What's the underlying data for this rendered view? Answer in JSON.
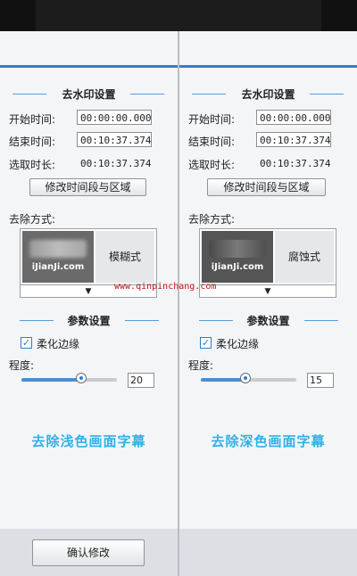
{
  "watermark_site": "www.qinpinchang.com",
  "panels": [
    {
      "section_title": "去水印设置",
      "start_label": "开始时间:",
      "start_value": "00:00:00.000",
      "end_label": "结束时间:",
      "end_value": "00:10:37.374",
      "duration_label": "选取时长:",
      "duration_value": "00:10:37.374",
      "modify_button": "修改时间段与区域",
      "method_label": "去除方式:",
      "method_thumb_text": "iJianJi.com",
      "method_name": "模糊式",
      "dropdown_arrow": "▼",
      "params_title": "参数设置",
      "soften_label": "柔化边缘",
      "soften_checked": true,
      "degree_label": "程度:",
      "degree_value": "20",
      "degree_fraction": 0.63,
      "caption": "去除浅色画面字幕",
      "confirm_button": "确认修改"
    },
    {
      "section_title": "去水印设置",
      "start_label": "开始时间:",
      "start_value": "00:00:00.000",
      "end_label": "结束时间:",
      "end_value": "00:10:37.374",
      "duration_label": "选取时长:",
      "duration_value": "00:10:37.374",
      "modify_button": "修改时间段与区域",
      "method_label": "去除方式:",
      "method_thumb_text": "iJianJi.com",
      "method_name": "腐蚀式",
      "dropdown_arrow": "▼",
      "params_title": "参数设置",
      "soften_label": "柔化边缘",
      "soften_checked": true,
      "degree_label": "程度:",
      "degree_value": "15",
      "degree_fraction": 0.47,
      "caption": "去除深色画面字幕"
    }
  ]
}
